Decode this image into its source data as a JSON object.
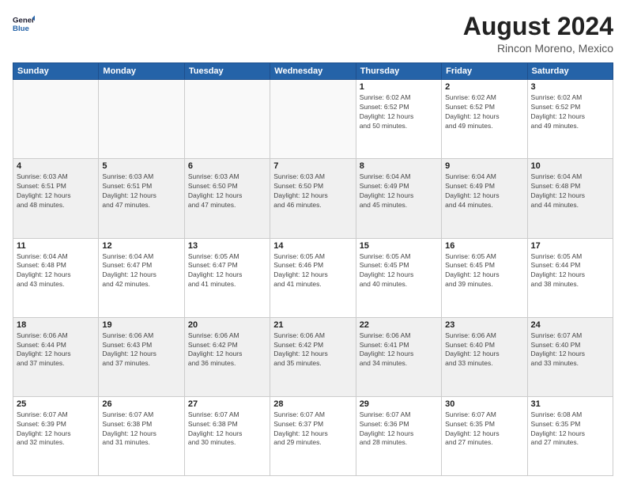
{
  "header": {
    "logo_line1": "General",
    "logo_line2": "Blue",
    "title": "August 2024",
    "subtitle": "Rincon Moreno, Mexico"
  },
  "weekdays": [
    "Sunday",
    "Monday",
    "Tuesday",
    "Wednesday",
    "Thursday",
    "Friday",
    "Saturday"
  ],
  "weeks": [
    [
      {
        "day": "",
        "info": ""
      },
      {
        "day": "",
        "info": ""
      },
      {
        "day": "",
        "info": ""
      },
      {
        "day": "",
        "info": ""
      },
      {
        "day": "1",
        "info": "Sunrise: 6:02 AM\nSunset: 6:52 PM\nDaylight: 12 hours\nand 50 minutes."
      },
      {
        "day": "2",
        "info": "Sunrise: 6:02 AM\nSunset: 6:52 PM\nDaylight: 12 hours\nand 49 minutes."
      },
      {
        "day": "3",
        "info": "Sunrise: 6:02 AM\nSunset: 6:52 PM\nDaylight: 12 hours\nand 49 minutes."
      }
    ],
    [
      {
        "day": "4",
        "info": "Sunrise: 6:03 AM\nSunset: 6:51 PM\nDaylight: 12 hours\nand 48 minutes."
      },
      {
        "day": "5",
        "info": "Sunrise: 6:03 AM\nSunset: 6:51 PM\nDaylight: 12 hours\nand 47 minutes."
      },
      {
        "day": "6",
        "info": "Sunrise: 6:03 AM\nSunset: 6:50 PM\nDaylight: 12 hours\nand 47 minutes."
      },
      {
        "day": "7",
        "info": "Sunrise: 6:03 AM\nSunset: 6:50 PM\nDaylight: 12 hours\nand 46 minutes."
      },
      {
        "day": "8",
        "info": "Sunrise: 6:04 AM\nSunset: 6:49 PM\nDaylight: 12 hours\nand 45 minutes."
      },
      {
        "day": "9",
        "info": "Sunrise: 6:04 AM\nSunset: 6:49 PM\nDaylight: 12 hours\nand 44 minutes."
      },
      {
        "day": "10",
        "info": "Sunrise: 6:04 AM\nSunset: 6:48 PM\nDaylight: 12 hours\nand 44 minutes."
      }
    ],
    [
      {
        "day": "11",
        "info": "Sunrise: 6:04 AM\nSunset: 6:48 PM\nDaylight: 12 hours\nand 43 minutes."
      },
      {
        "day": "12",
        "info": "Sunrise: 6:04 AM\nSunset: 6:47 PM\nDaylight: 12 hours\nand 42 minutes."
      },
      {
        "day": "13",
        "info": "Sunrise: 6:05 AM\nSunset: 6:47 PM\nDaylight: 12 hours\nand 41 minutes."
      },
      {
        "day": "14",
        "info": "Sunrise: 6:05 AM\nSunset: 6:46 PM\nDaylight: 12 hours\nand 41 minutes."
      },
      {
        "day": "15",
        "info": "Sunrise: 6:05 AM\nSunset: 6:45 PM\nDaylight: 12 hours\nand 40 minutes."
      },
      {
        "day": "16",
        "info": "Sunrise: 6:05 AM\nSunset: 6:45 PM\nDaylight: 12 hours\nand 39 minutes."
      },
      {
        "day": "17",
        "info": "Sunrise: 6:05 AM\nSunset: 6:44 PM\nDaylight: 12 hours\nand 38 minutes."
      }
    ],
    [
      {
        "day": "18",
        "info": "Sunrise: 6:06 AM\nSunset: 6:44 PM\nDaylight: 12 hours\nand 37 minutes."
      },
      {
        "day": "19",
        "info": "Sunrise: 6:06 AM\nSunset: 6:43 PM\nDaylight: 12 hours\nand 37 minutes."
      },
      {
        "day": "20",
        "info": "Sunrise: 6:06 AM\nSunset: 6:42 PM\nDaylight: 12 hours\nand 36 minutes."
      },
      {
        "day": "21",
        "info": "Sunrise: 6:06 AM\nSunset: 6:42 PM\nDaylight: 12 hours\nand 35 minutes."
      },
      {
        "day": "22",
        "info": "Sunrise: 6:06 AM\nSunset: 6:41 PM\nDaylight: 12 hours\nand 34 minutes."
      },
      {
        "day": "23",
        "info": "Sunrise: 6:06 AM\nSunset: 6:40 PM\nDaylight: 12 hours\nand 33 minutes."
      },
      {
        "day": "24",
        "info": "Sunrise: 6:07 AM\nSunset: 6:40 PM\nDaylight: 12 hours\nand 33 minutes."
      }
    ],
    [
      {
        "day": "25",
        "info": "Sunrise: 6:07 AM\nSunset: 6:39 PM\nDaylight: 12 hours\nand 32 minutes."
      },
      {
        "day": "26",
        "info": "Sunrise: 6:07 AM\nSunset: 6:38 PM\nDaylight: 12 hours\nand 31 minutes."
      },
      {
        "day": "27",
        "info": "Sunrise: 6:07 AM\nSunset: 6:38 PM\nDaylight: 12 hours\nand 30 minutes."
      },
      {
        "day": "28",
        "info": "Sunrise: 6:07 AM\nSunset: 6:37 PM\nDaylight: 12 hours\nand 29 minutes."
      },
      {
        "day": "29",
        "info": "Sunrise: 6:07 AM\nSunset: 6:36 PM\nDaylight: 12 hours\nand 28 minutes."
      },
      {
        "day": "30",
        "info": "Sunrise: 6:07 AM\nSunset: 6:35 PM\nDaylight: 12 hours\nand 27 minutes."
      },
      {
        "day": "31",
        "info": "Sunrise: 6:08 AM\nSunset: 6:35 PM\nDaylight: 12 hours\nand 27 minutes."
      }
    ]
  ]
}
